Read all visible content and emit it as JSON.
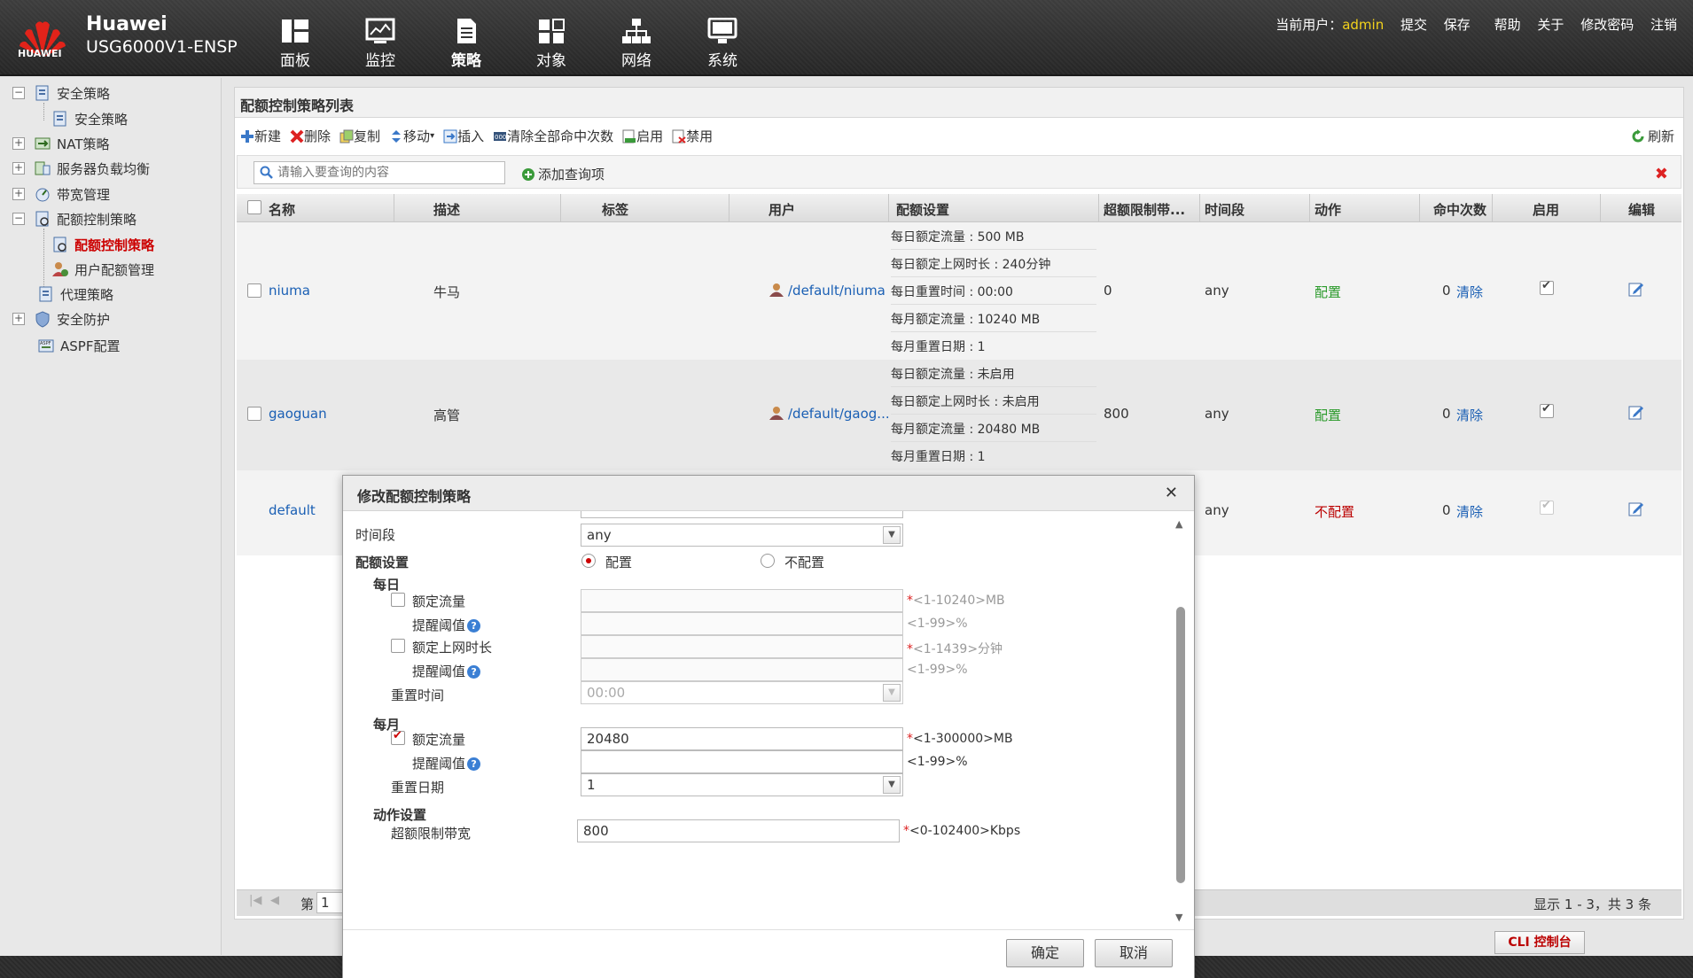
{
  "header": {
    "logo_text": "HUAWEI",
    "brand": "Huawei",
    "device": "USG6000V1-ENSP",
    "nav": [
      {
        "label": "面板",
        "icon": "dashboard-icon"
      },
      {
        "label": "监控",
        "icon": "monitor-icon"
      },
      {
        "label": "策略",
        "icon": "policy-icon"
      },
      {
        "label": "对象",
        "icon": "object-icon"
      },
      {
        "label": "网络",
        "icon": "network-icon"
      },
      {
        "label": "系统",
        "icon": "system-icon"
      }
    ],
    "current_user_label": "当前用户：",
    "current_user": "admin",
    "links": [
      "提交",
      "保存",
      "帮助",
      "关于",
      "修改密码",
      "注销"
    ]
  },
  "sidebar": {
    "items": [
      {
        "label": "安全策略"
      },
      {
        "label": "安全策略"
      },
      {
        "label": "NAT策略"
      },
      {
        "label": "服务器负载均衡"
      },
      {
        "label": "带宽管理"
      },
      {
        "label": "配额控制策略"
      },
      {
        "label": "配额控制策略"
      },
      {
        "label": "用户配额管理"
      },
      {
        "label": "代理策略"
      },
      {
        "label": "安全防护"
      },
      {
        "label": "ASPF配置"
      }
    ]
  },
  "main": {
    "title": "配额控制策略列表",
    "toolbar": [
      "新建",
      "删除",
      "复制",
      "移动",
      "插入",
      "清除全部命中次数",
      "启用",
      "禁用"
    ],
    "refresh": "刷新",
    "search_placeholder": "请输入要查询的内容",
    "add_query": "添加查询项",
    "columns": [
      "名称",
      "描述",
      "标签",
      "用户",
      "配额设置",
      "超额限制带...",
      "时间段",
      "动作",
      "命中次数",
      "启用",
      "编辑"
    ],
    "rows": [
      {
        "name": "niuma",
        "desc": "牛马",
        "tag": "",
        "user": "/default/niuma",
        "quota": [
          "每日额定流量 : 500 MB",
          "每日额定上网时长 : 240分钟",
          "每日重置时间 : 00:00",
          "每月额定流量 : 10240 MB",
          "每月重置日期 : 1"
        ],
        "limit": "0",
        "time": "any",
        "action": "配置",
        "hits": "0",
        "clear": "清除",
        "enabled": true
      },
      {
        "name": "gaoguan",
        "desc": "高管",
        "tag": "",
        "user": "/default/gaog...",
        "quota": [
          "每日额定流量 : 未启用",
          "每日额定上网时长 : 未启用",
          "每月额定流量 : 20480 MB",
          "每月重置日期 : 1"
        ],
        "limit": "800",
        "time": "any",
        "action": "配置",
        "hits": "0",
        "clear": "清除",
        "enabled": true
      },
      {
        "name": "default",
        "desc": "",
        "tag": "",
        "user": "",
        "quota": [],
        "limit": "",
        "time": "any",
        "action": "不配置",
        "hits": "0",
        "clear": "清除",
        "enabled": true
      }
    ],
    "pager_prefix": "第",
    "pager_page": "1",
    "pager_summary": "显示 1 - 3，共 3 条"
  },
  "cli_button": "CLI 控制台",
  "modal": {
    "title": "修改配额控制策略",
    "time_label": "时间段",
    "time_value": "any",
    "quota_label": "配额设置",
    "radio_on": "配置",
    "radio_off": "不配置",
    "daily_label": "每日",
    "daily_traffic": "额定流量",
    "daily_traffic_hint": "<1-10240>MB",
    "alert_threshold": "提醒阈值",
    "threshold_hint": "<1-99>%",
    "daily_time": "额定上网时长",
    "daily_time_hint": "<1-1439>分钟",
    "reset_time_label": "重置时间",
    "reset_time_value": "00:00",
    "monthly_label": "每月",
    "monthly_traffic": "额定流量",
    "monthly_traffic_value": "20480",
    "monthly_traffic_hint": "<1-300000>MB",
    "reset_date_label": "重置日期",
    "reset_date_value": "1",
    "action_label": "动作设置",
    "limit_label": "超额限制带宽",
    "limit_value": "800",
    "limit_hint": "<0-102400>Kbps",
    "ok": "确定",
    "cancel": "取消"
  }
}
